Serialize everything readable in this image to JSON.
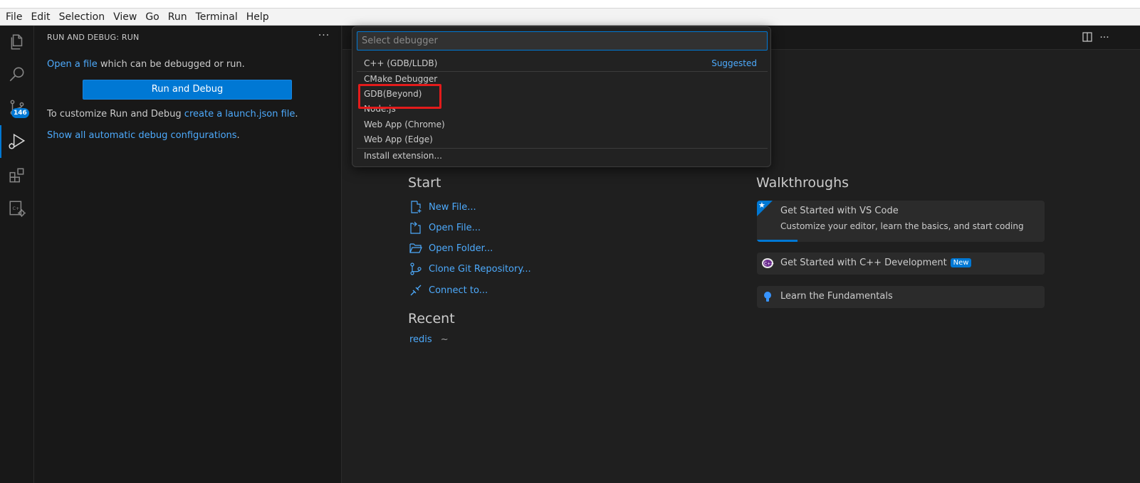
{
  "menubar": {
    "items": [
      "File",
      "Edit",
      "Selection",
      "View",
      "Go",
      "Run",
      "Terminal",
      "Help"
    ]
  },
  "activitybar": {
    "source_control_badge": "146",
    "icons": [
      "explorer-icon",
      "search-icon",
      "source-control-icon",
      "run-debug-icon",
      "extensions-icon",
      "cmake-icon"
    ]
  },
  "sidebar": {
    "title": "RUN AND DEBUG: RUN",
    "open_file_link": "Open a file",
    "open_file_rest": " which can be debugged or run.",
    "run_button": "Run and Debug",
    "customize_prefix": "To customize Run and Debug ",
    "create_launch_link": "create a launch.json file",
    "customize_suffix": ".",
    "show_all_link": "Show all automatic debug configurations",
    "show_all_suffix": "."
  },
  "quickpick": {
    "placeholder": "Select debugger",
    "items": [
      {
        "label": "C++ (GDB/LLDB)",
        "tag": "Suggested"
      },
      {
        "label": "CMake Debugger"
      },
      {
        "label": "GDB(Beyond)"
      },
      {
        "label": "Node.js"
      },
      {
        "label": "Web App (Chrome)"
      },
      {
        "label": "Web App (Edge)"
      },
      {
        "label": "Install extension..."
      }
    ]
  },
  "welcome": {
    "start_title": "Start",
    "start_items": [
      "New File...",
      "Open File...",
      "Open Folder...",
      "Clone Git Repository...",
      "Connect to..."
    ],
    "recent_title": "Recent",
    "recent": {
      "name": "redis",
      "path": "~"
    },
    "walkthroughs_title": "Walkthroughs",
    "walkthroughs": [
      {
        "title": "Get Started with VS Code",
        "desc": "Customize your editor, learn the basics, and start coding"
      },
      {
        "title": "Get Started with C++ Development",
        "badge": "New"
      },
      {
        "title": "Learn the Fundamentals"
      }
    ]
  },
  "colors": {
    "accent": "#0078d4",
    "link": "#4daafc",
    "highlight": "#e31b1b"
  }
}
